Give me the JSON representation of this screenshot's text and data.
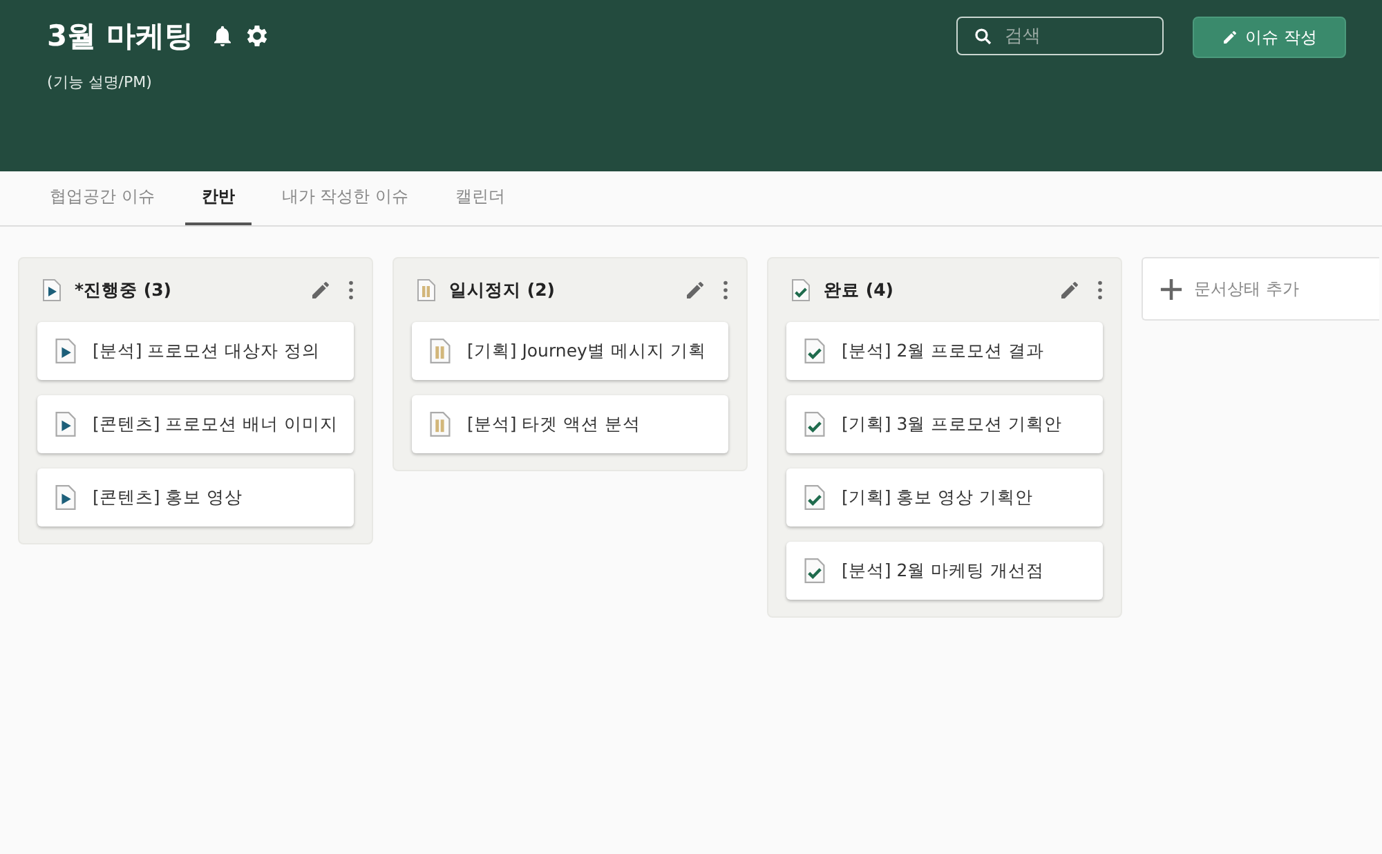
{
  "header": {
    "title": "3월 마케팅",
    "subtitle": "(기능 설명/PM)",
    "search": {
      "placeholder": "검색"
    },
    "new_issue_button": "이슈 작성"
  },
  "tabs": [
    {
      "label": "협업공간 이슈",
      "selected": false
    },
    {
      "label": "칸반",
      "selected": true
    },
    {
      "label": "내가 작성한 이슈",
      "selected": false
    },
    {
      "label": "캘린더",
      "selected": false
    }
  ],
  "columns": [
    {
      "kind": "progress",
      "title": "*진행중 (3)",
      "cards": [
        "[분석] 프로모션 대상자 정의",
        "[콘텐츠] 프로모션 배너 이미지",
        "[콘텐츠] 홍보 영상"
      ]
    },
    {
      "kind": "paused",
      "title": "일시정지 (2)",
      "cards": [
        "[기획] Journey별 메시지 기획",
        "[분석] 타겟 액션 분석"
      ]
    },
    {
      "kind": "done",
      "title": "완료 (4)",
      "cards": [
        "[분석] 2월 프로모션 결과",
        "[기획] 3월 프로모션 기획안",
        "[기획] 홍보 영상 기획안",
        "[분석] 2월 마케팅 개선점"
      ]
    }
  ],
  "add_status_button": "문서상태 추가"
}
